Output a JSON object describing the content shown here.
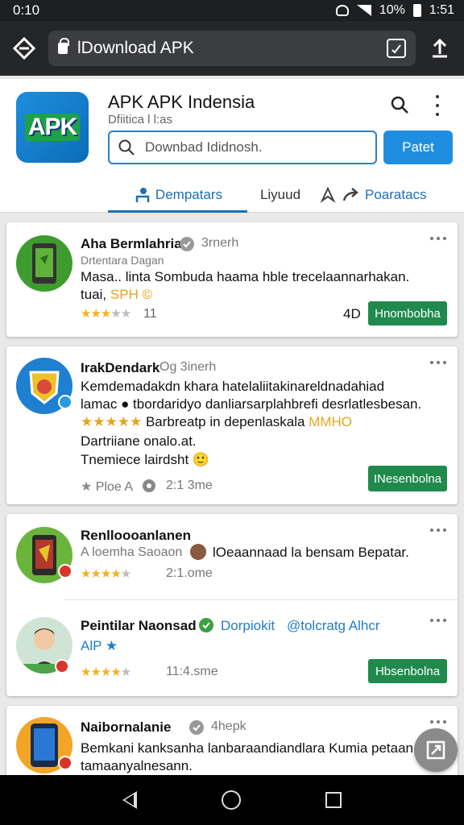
{
  "status": {
    "time": "0:10",
    "battery": "10%",
    "clock": "1:51"
  },
  "browser": {
    "url": "lDownload APK"
  },
  "app": {
    "title": "APK APK Indensia",
    "subtitle": "Dfiitica l l:as",
    "logo_text": "APK",
    "search_placeholder": "Downbad Ididnosh.",
    "action_button": "Patet",
    "tabs": [
      {
        "label": "Dempatars",
        "active": true
      },
      {
        "label": "Liyuud"
      },
      {
        "label": ""
      },
      {
        "label": "Poaratacs"
      }
    ]
  },
  "cards": [
    {
      "name": "Aha Bermlahria",
      "meta": "3rnerh",
      "sub": "Drtentara Dagan",
      "line1": "Masa.. linta Sombuda haama hble trecelaannarhakan.",
      "line2_pre": "tuai, ",
      "line2_gold": "SPH ©",
      "rating_stars": 3.5,
      "count": "11",
      "label_right": "4D",
      "button": "Hnombobha"
    },
    {
      "name": "IrakDendark",
      "meta": "Og 3inerh",
      "line1": "Kemdemadakdn khara hatelaliitakinareldnadahiad",
      "line2": "lamac ●  tbordaridyo danliarsarplahbrefi desrlatlesbesan.",
      "line3_text": "Barbreatp in depenlaskala",
      "line3_gold": "MMHO",
      "rating_stars": 5,
      "line4": "Dartriiane onalo.at.",
      "line5": "Tnemiece lairdsht",
      "emoji": "🙂",
      "foot_text": "Ploe A",
      "foot_time": "2:1 3me",
      "button": "INesenbolna"
    },
    {
      "name": "Renlloooanlanen",
      "meta": "A loemha Saoaon",
      "meta2": "lOeaannaad la bensam Bepatar.",
      "rating_stars": 3.5,
      "time": "2:1.ome"
    },
    {
      "name": "Peintilar Naonsad",
      "link1": "Dorpiokit",
      "link2": "@tolcratg Alhcr",
      "sub": "AlP",
      "rating_stars": 3.5,
      "time": "11:4.sme",
      "button": "Hbsenbolna"
    },
    {
      "name": "Naibornalanie",
      "meta": "4hepk",
      "line1": "Bemkani kanksanha lanbaraandiandlara Kumia petaan",
      "line2": "tamaanyalnesann."
    }
  ],
  "colors": {
    "accent_blue": "#1f8ee0",
    "brand_green": "#1f8a4c",
    "star_gold": "#f2b21f"
  }
}
